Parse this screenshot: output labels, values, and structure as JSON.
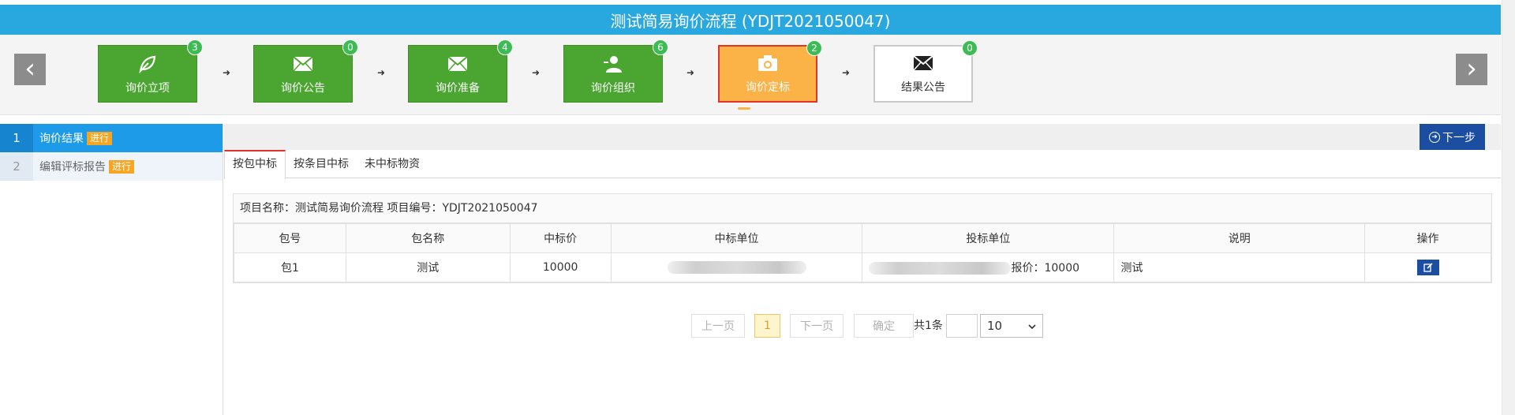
{
  "title": "测试简易询价流程 (YDJT2021050047)",
  "nav": {
    "prev": "‹",
    "next": "›"
  },
  "steps": [
    {
      "label": "询价立项",
      "count": "3",
      "icon": "leaf-icon"
    },
    {
      "label": "询价公告",
      "count": "0",
      "icon": "envelope-icon"
    },
    {
      "label": "询价准备",
      "count": "4",
      "icon": "envelope-icon"
    },
    {
      "label": "询价组织",
      "count": "6",
      "icon": "user-icon"
    },
    {
      "label": "询价定标",
      "count": "2",
      "icon": "camera-icon",
      "state": "active"
    },
    {
      "label": "结果公告",
      "count": "0",
      "icon": "envelope-icon",
      "state": "pending"
    }
  ],
  "sidebar": {
    "items": [
      {
        "num": "1",
        "label": "询价结果",
        "tag": "进行"
      },
      {
        "num": "2",
        "label": "编辑评标报告",
        "tag": "进行"
      }
    ]
  },
  "toolbar": {
    "next_label": "下一步"
  },
  "tabs": [
    "按包中标",
    "按条目中标",
    "未中标物资"
  ],
  "project": {
    "line": "项目名称：测试简易询价流程 项目编号：YDJT2021050047"
  },
  "table": {
    "headers": [
      "包号",
      "包名称",
      "中标价",
      "中标单位",
      "投标单位",
      "说明",
      "操作"
    ],
    "rows": [
      {
        "pkg_no": "包1",
        "pkg_name": "测试",
        "price": "10000",
        "bid_suffix": "报价：10000",
        "note": "测试"
      }
    ]
  },
  "pagination": {
    "prev": "上一页",
    "current": "1",
    "next": "下一页",
    "confirm": "确定",
    "total": "共1条",
    "page_size": "10"
  },
  "colors": {
    "title_bar": "#29a8e0",
    "step_done": "#4aa630",
    "step_active": "#fbb247",
    "badge": "#3dbb54",
    "primary_button": "#1b4ea0",
    "sidebar_active": "#1e9be8",
    "tag": "#f6a623"
  }
}
